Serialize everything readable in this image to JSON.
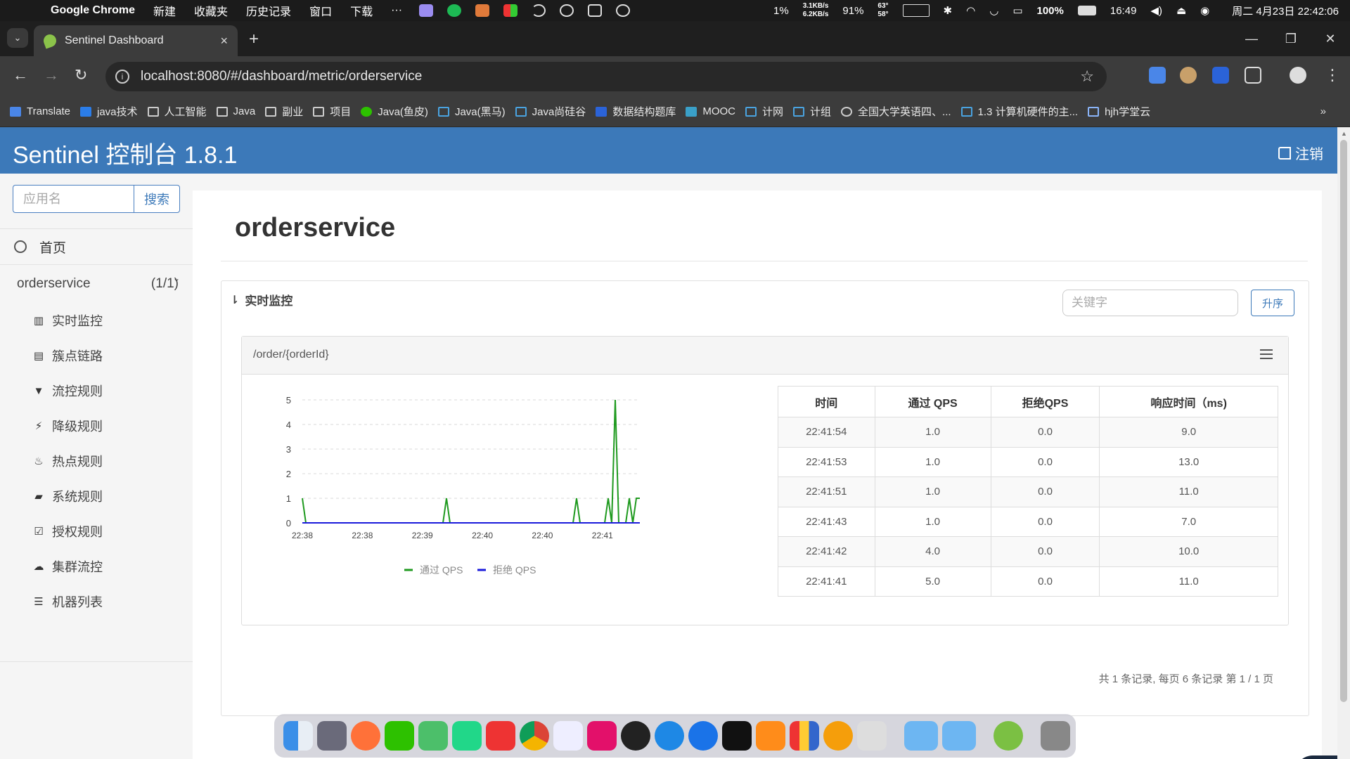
{
  "menubar": {
    "app_name": "Google Chrome",
    "items": [
      "新建",
      "收藏夹",
      "历史记录",
      "窗口",
      "下载",
      "···"
    ],
    "cpu": "1%",
    "net_up": "3.1KB/s",
    "net_down": "6.2KB/s",
    "mem": "91%",
    "temp_1": "63°",
    "temp_2": "58°",
    "battery": "100%",
    "clock_short": "16:49",
    "datetime": "周二 4月23日 22:42:06"
  },
  "browser": {
    "tab_title": "Sentinel Dashboard",
    "tab_close": "×",
    "new_tab": "+",
    "url": "localhost:8080/#/dashboard/metric/orderservice",
    "window_minimize": "—",
    "window_restore": "❐",
    "window_close": "✕",
    "bookmarks": [
      {
        "label": "Translate",
        "icon": "translate-icon"
      },
      {
        "label": "java技术",
        "icon": "java-icon"
      },
      {
        "label": "人工智能",
        "icon": "folder-icon"
      },
      {
        "label": "Java",
        "icon": "folder-icon"
      },
      {
        "label": "副业",
        "icon": "folder-icon"
      },
      {
        "label": "项目",
        "icon": "folder-icon"
      },
      {
        "label": "Java(鱼皮)",
        "icon": "wechat-icon"
      },
      {
        "label": "Java(黑马)",
        "icon": "bilibili-icon"
      },
      {
        "label": "Java尚硅谷",
        "icon": "bilibili-icon"
      },
      {
        "label": "数据结构题库",
        "icon": "q-icon"
      },
      {
        "label": "MOOC",
        "icon": "mooc-icon"
      },
      {
        "label": "计网",
        "icon": "bilibili-icon"
      },
      {
        "label": "计组",
        "icon": "bilibili-icon"
      },
      {
        "label": "全国大学英语四、...",
        "icon": "globe-icon"
      },
      {
        "label": "1.3 计算机硬件的主...",
        "icon": "bilibili-icon"
      },
      {
        "label": "hjh学堂云",
        "icon": "cloud-icon"
      }
    ],
    "bookmarks_more": "»"
  },
  "app": {
    "brand": "Sentinel 控制台 1.8.1",
    "logout": "注销",
    "search_placeholder": "应用名",
    "search_button": "搜索",
    "home": "首页",
    "app_name": "orderservice",
    "app_count": "(1/1)",
    "menu": [
      {
        "label": "实时监控",
        "icon": "bar-chart-icon",
        "glyph": "▥"
      },
      {
        "label": "簇点链路",
        "icon": "list-alt-icon",
        "glyph": "▤"
      },
      {
        "label": "流控规则",
        "icon": "filter-icon",
        "glyph": "▼"
      },
      {
        "label": "降级规则",
        "icon": "flash-icon",
        "glyph": "⚡"
      },
      {
        "label": "热点规则",
        "icon": "fire-icon",
        "glyph": "♨"
      },
      {
        "label": "系统规则",
        "icon": "lock-icon",
        "glyph": "▰"
      },
      {
        "label": "授权规则",
        "icon": "check-icon",
        "glyph": "☑"
      },
      {
        "label": "集群流控",
        "icon": "cloud-icon",
        "glyph": "☁"
      },
      {
        "label": "机器列表",
        "icon": "th-list-icon",
        "glyph": "☰"
      }
    ]
  },
  "main": {
    "title": "orderservice",
    "panel_title": "实时监控",
    "keyword_placeholder": "关键字",
    "sort_button": "升序",
    "resource": "/order/{orderId}",
    "table": {
      "headers": [
        "时间",
        "通过 QPS",
        "拒绝QPS",
        "响应时间（ms)"
      ],
      "rows": [
        [
          "22:41:54",
          "1.0",
          "0.0",
          "9.0"
        ],
        [
          "22:41:53",
          "1.0",
          "0.0",
          "13.0"
        ],
        [
          "22:41:51",
          "1.0",
          "0.0",
          "11.0"
        ],
        [
          "22:41:43",
          "1.0",
          "0.0",
          "7.0"
        ],
        [
          "22:41:42",
          "4.0",
          "0.0",
          "10.0"
        ],
        [
          "22:41:41",
          "5.0",
          "0.0",
          "11.0"
        ]
      ]
    },
    "pagination": "共 1 条记录, 每页 6 条记录 第 1 / 1 页"
  },
  "chart_data": {
    "type": "line",
    "ylim": [
      0,
      5
    ],
    "yticks": [
      "0",
      "1",
      "2",
      "3",
      "4",
      "5"
    ],
    "xticks": [
      "22:38",
      "22:38",
      "22:39",
      "22:40",
      "22:40",
      "22:41"
    ],
    "grid": true,
    "legend_position": "bottom",
    "series": [
      {
        "name": "通过 QPS",
        "color": "#1f9a1f",
        "points": [
          [
            0,
            1
          ],
          [
            1,
            0
          ],
          [
            40,
            0
          ],
          [
            41,
            1
          ],
          [
            42,
            0
          ],
          [
            77,
            0
          ],
          [
            78,
            1
          ],
          [
            79,
            0
          ],
          [
            86,
            0
          ],
          [
            87,
            1
          ],
          [
            88,
            0
          ],
          [
            89,
            5
          ],
          [
            90,
            0
          ],
          [
            92,
            0
          ],
          [
            93,
            1
          ],
          [
            94,
            0
          ],
          [
            95,
            1
          ],
          [
            96,
            1
          ]
        ]
      },
      {
        "name": "拒绝 QPS",
        "color": "#1a1adb",
        "points": [
          [
            0,
            0
          ],
          [
            96,
            0
          ]
        ]
      }
    ]
  }
}
